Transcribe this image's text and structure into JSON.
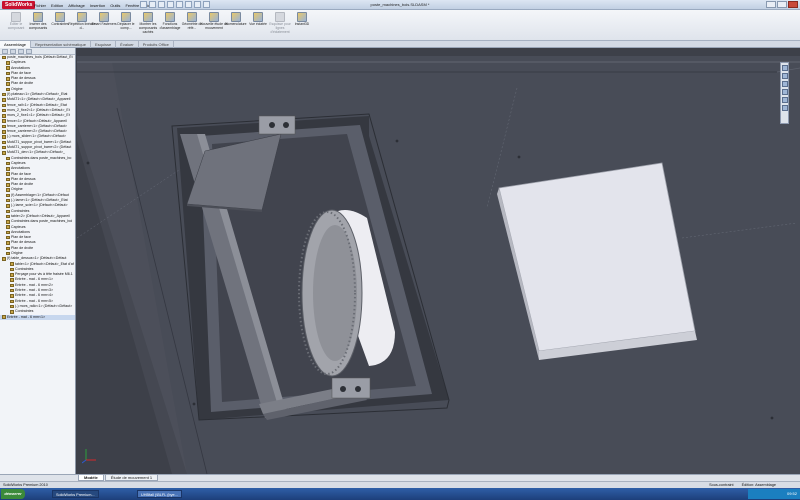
{
  "app": {
    "name": "SolidWorks",
    "doc_title": "poste_machines_bois.SLDASM *",
    "menu": [
      "Fichier",
      "Edition",
      "Affichage",
      "Insertion",
      "Outils",
      "Fenêtre",
      "Aide"
    ]
  },
  "ribbon": {
    "buttons": [
      {
        "label": "Éditer le composant",
        "dim": true
      },
      {
        "label": "Insérer des composants",
        "dim": false
      },
      {
        "label": "Contraintes",
        "dim": false
      },
      {
        "label": "Répétition linéaire d...",
        "dim": false
      },
      {
        "label": "Smart Fasteners",
        "dim": false
      },
      {
        "label": "Déplacer le comp...",
        "dim": false
      },
      {
        "label": "Montrer les composants cachés",
        "dim": false
      },
      {
        "label": "Fonctions d'assemblage",
        "dim": false
      },
      {
        "label": "Géométrie de réfé...",
        "dim": false
      },
      {
        "label": "Nouvelle étude de mouvement",
        "dim": false
      },
      {
        "label": "Nomenclature",
        "dim": false
      },
      {
        "label": "Vue éclatée",
        "dim": false
      },
      {
        "label": "Esquisse pour lignes d'éclatement",
        "dim": true
      },
      {
        "label": "Instant3D",
        "dim": false
      }
    ]
  },
  "command_tabs": [
    {
      "label": "Assemblage",
      "active": true
    },
    {
      "label": "Représentation schématique",
      "active": false
    },
    {
      "label": "Esquisse",
      "active": false
    },
    {
      "label": "Évaluer",
      "active": false
    },
    {
      "label": "Produits Office",
      "active": false
    }
  ],
  "tree": [
    "poste_machines_bois (Défaut<Défaut_Ét",
    "Capteurs",
    "Annotations",
    "Plan de face",
    "Plan de dessus",
    "Plan de droite",
    "Origine",
    "(f) plateau<1> (Défaut<<Défaut>_Etat",
    "MotAT1<1> (Défaut<<Défaut>_Appareil",
    "fence_rail<1> (Défaut<<Défaut>_Etat",
    "mors_2_fixe2<1> (Défaut<<Défaut>_Et",
    "mors_2_fixe1<1> (Défaut<<Défaut>_Et",
    "fence<1> (Défaut<<Défaut>_Appareil",
    "fence_carrierre<1> (Défaut<<Défaut>",
    "fence_carrierre<2> (Défaut<<Défaut>",
    "(-) mors_slider<1> (Défaut<<Défaut>",
    "MotAT1_suppor_pivot_barre<1> (Défaut",
    "MotAT1_suppor_pivot_barre<2> (Défaut",
    "MotAT1_dev<1> (Défaut<<Défaut>_",
    "Contraintes dans poste_machines_bo",
    "Capteurs",
    "Annotations",
    "Plan de face",
    "Plan de dessus",
    "Plan de droite",
    "Origine",
    "(f) Assemblage<1> (Défaut<<Défaut",
    "(-) lame<1> (Défaut<<Défaut>_Etat",
    "(-) lame_scie<1> (Défaut<<Défaut>",
    "Contraintes",
    "table<2> (Défaut<<Défaut>_Appareil",
    "Contraintes dans poste_machines_boi",
    "Capteurs",
    "Annotations",
    "Plan de face",
    "Plan de dessus",
    "Plan de droite",
    "Origine",
    "(f) table_dessus<1> (Défaut<<Défaut",
    "table<1> (Défaut<<Défaut>_Etat d'af",
    "Contraintes",
    "Perçage pour vis à tête fraisée M6.1",
    "Entrée - mat - 6 mm<1>",
    "Entrée - mat - 6 mm<2>",
    "Entrée - mat - 6 mm<3>",
    "Entrée - mat - 6 mm<4>",
    "Entrée - mat - 6 mm<5>",
    "(-) mors_rallo<1> (Défaut<<Défaut>",
    "Contraintes",
    "Entrée - mat - 6 mm<1>"
  ],
  "bottom_tabs": [
    {
      "label": "Modèle",
      "active": true
    },
    {
      "label": "Étude de mouvement 1",
      "active": false
    }
  ],
  "status": {
    "left": "SolidWorks Premium 2010",
    "right": [
      "Sous-contraint",
      "Édition: Assemblage"
    ]
  },
  "taskbar": {
    "start": "démarrer",
    "items": [
      {
        "label": "SolidWorks Premium...",
        "active": true
      },
      {
        "label": "UHBfall (\\BLFL (bye...",
        "active": false
      }
    ],
    "clock": "09:52"
  },
  "colors": {
    "accent_red": "#c8102e",
    "viewport_bg": "#3c3f48",
    "sheet_light": "#e3e4ec"
  }
}
